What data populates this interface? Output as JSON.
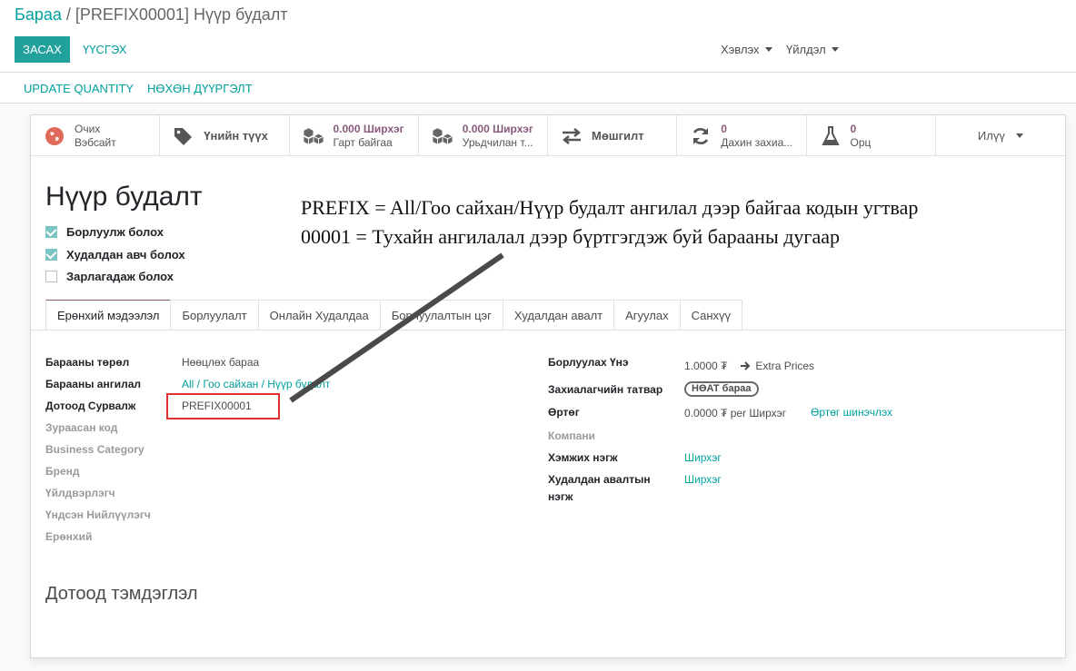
{
  "breadcrumb": {
    "parent": "Бараа",
    "separator": "/",
    "current": "[PREFIX00001] Нүүр будалт"
  },
  "toolbar": {
    "edit": "ЗАСАХ",
    "create": "ҮҮСГЭХ",
    "print": "Хэвлэх",
    "action": "Үйлдэл"
  },
  "actions": {
    "update_quantity": "UPDATE QUANTITY",
    "replenish": "НӨХӨН ДҮҮРГЭЛТ"
  },
  "smart_buttons": [
    {
      "icon": "globe-icon",
      "line1": "Очих",
      "line2": "Вэбсайт"
    },
    {
      "icon": "tags-icon",
      "single": "Үнийн түүх"
    },
    {
      "icon": "cubes-icon",
      "line1": "0.000 Ширхэг",
      "line2": "Гарт байгаа"
    },
    {
      "icon": "cubes-icon",
      "line1": "0.000 Ширхэг",
      "line2": "Урьдчилан т..."
    },
    {
      "icon": "exchange-icon",
      "single": "Мөшгилт"
    },
    {
      "icon": "refresh-icon",
      "line1": "0",
      "line2": "Дахин захиа..."
    },
    {
      "icon": "flask-icon",
      "line1": "0",
      "line2": "Орц"
    },
    {
      "icon": "caret-icon",
      "single": "Илүү"
    }
  ],
  "product": {
    "name": "Нүүр будалт",
    "checkboxes": [
      {
        "label": "Борлуулж болох",
        "checked": true
      },
      {
        "label": "Худалдан авч болох",
        "checked": true
      },
      {
        "label": "Зарлагадаж болох",
        "checked": false
      }
    ]
  },
  "annotation": {
    "line1": "PREFIX = All/Гоо сайхан/Нүүр будалт  ангилал дээр байгаа кодын угтвар",
    "line2": "00001 = Тухайн ангилалал дээр бүртгэгдэж буй барааны дугаар"
  },
  "tabs": [
    "Ерөнхий мэдээлэл",
    "Борлуулалт",
    "Онлайн Худалдаа",
    "Борлуулалтын цэг",
    "Худалдан авалт",
    "Агуулах",
    "Санхүү"
  ],
  "left_fields": {
    "type_label": "Барааны төрөл",
    "type_value": "Нөөцлөх бараа",
    "category_label": "Барааны ангилал",
    "category_value": "All / Гоо сайхан / Нүүр будалт",
    "ref_label": "Дотоод Сурвалж",
    "ref_value": "PREFIX00001",
    "barcode_label": "Зураасан код",
    "business_category_label": "Business Category",
    "brand_label": "Бренд",
    "manufacturer_label": "Үйлдвэрлэгч",
    "supplier_label": "Үндсэн Нийлүүлэгч",
    "general_label": "Ерөнхий"
  },
  "right_fields": {
    "price_label": "Борлуулах Үнэ",
    "price_value": "1.0000 ₮",
    "extra_prices": "Extra Prices",
    "tax_label": "Захиалагчийн татвар",
    "tax_value": "НӨАТ бараа",
    "cost_label": "Өртөг",
    "cost_value": "0.0000 ₮ per Ширхэг",
    "cost_update": "Өртөг шинэчлэх",
    "company_label": "Компани",
    "uom_label": "Хэмжих нэгж",
    "uom_value": "Ширхэг",
    "purchase_uom_label_1": "Худалдан авалтын",
    "purchase_uom_label_2": "нэгж",
    "purchase_uom_value": "Ширхэг"
  },
  "notes_title": "Дотоод тэмдэглэл"
}
